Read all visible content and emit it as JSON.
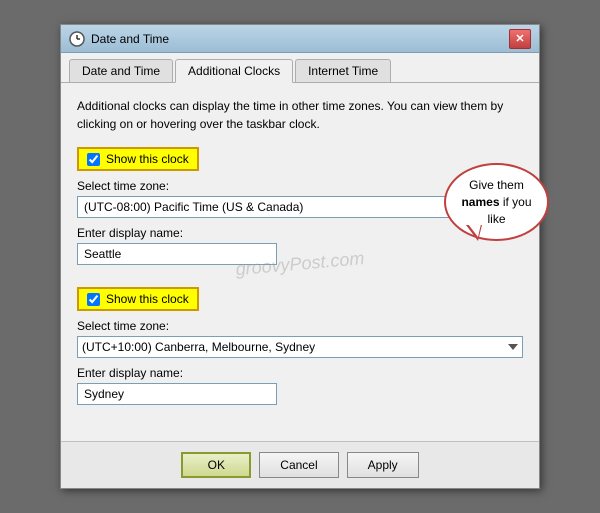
{
  "window": {
    "title": "Date and Time",
    "close_label": "✕"
  },
  "tabs": [
    {
      "id": "date-time",
      "label": "Date and Time",
      "active": false
    },
    {
      "id": "additional-clocks",
      "label": "Additional Clocks",
      "active": true
    },
    {
      "id": "internet-time",
      "label": "Internet Time",
      "active": false
    }
  ],
  "description": "Additional clocks can display the time in other time zones. You can view them by clicking on or hovering over the taskbar clock.",
  "clock1": {
    "checkbox_label": "Show this clock",
    "timezone_label": "Select time zone:",
    "timezone_value": "(UTC-08:00) Pacific Time (US & Canada)",
    "display_name_label": "Enter display name:",
    "display_name_value": "Seattle"
  },
  "clock2": {
    "checkbox_label": "Show this clock",
    "timezone_label": "Select time zone:",
    "timezone_value": "(UTC+10:00) Canberra, Melbourne, Sydney",
    "display_name_label": "Enter display name:",
    "display_name_value": "Sydney"
  },
  "speech_bubble": {
    "text_normal": "Give them ",
    "text_bold": "names",
    "text_end": " if you like"
  },
  "footer": {
    "ok_label": "OK",
    "cancel_label": "Cancel",
    "apply_label": "Apply"
  },
  "watermark": "groovyPost.com"
}
